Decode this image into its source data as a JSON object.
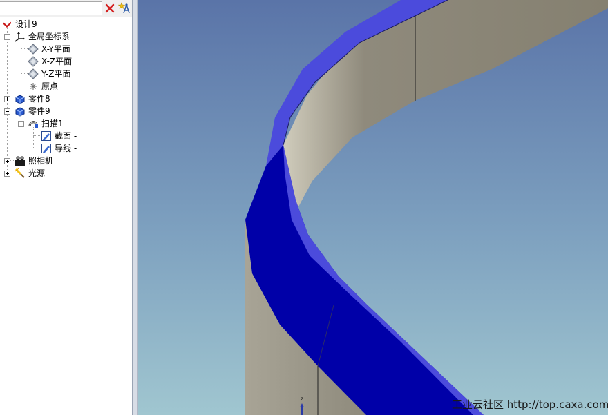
{
  "search": {
    "value": "",
    "placeholder": ""
  },
  "tree": {
    "root": "设计9",
    "items": [
      {
        "label": "全局坐标系",
        "icon": "axes-icon"
      },
      {
        "label": "X-Y平面",
        "icon": "plane-icon"
      },
      {
        "label": "X-Z平面",
        "icon": "plane-icon"
      },
      {
        "label": "Y-Z平面",
        "icon": "plane-icon"
      },
      {
        "label": "原点",
        "icon": "origin-icon"
      },
      {
        "label": "零件8",
        "icon": "part-icon"
      },
      {
        "label": "零件9",
        "icon": "part-icon"
      },
      {
        "label": "扫描1",
        "icon": "sweep-feature-icon"
      },
      {
        "label": "截面 -",
        "icon": "sketch-icon"
      },
      {
        "label": "导线 -",
        "icon": "sketch-icon"
      },
      {
        "label": "照相机",
        "icon": "camera-icon"
      },
      {
        "label": "光源",
        "icon": "light-icon"
      }
    ]
  },
  "viewport": {
    "triad_axis": "z",
    "model": "swept-band",
    "colors": {
      "top_face": "#4b4bdc",
      "side_face": "#0000a8",
      "inner_face": "#8a8578",
      "bg_top": "#5a74a8",
      "bg_bottom": "#a0c6d0"
    }
  },
  "watermark": "工业云社区 http://top.caxa.com/"
}
